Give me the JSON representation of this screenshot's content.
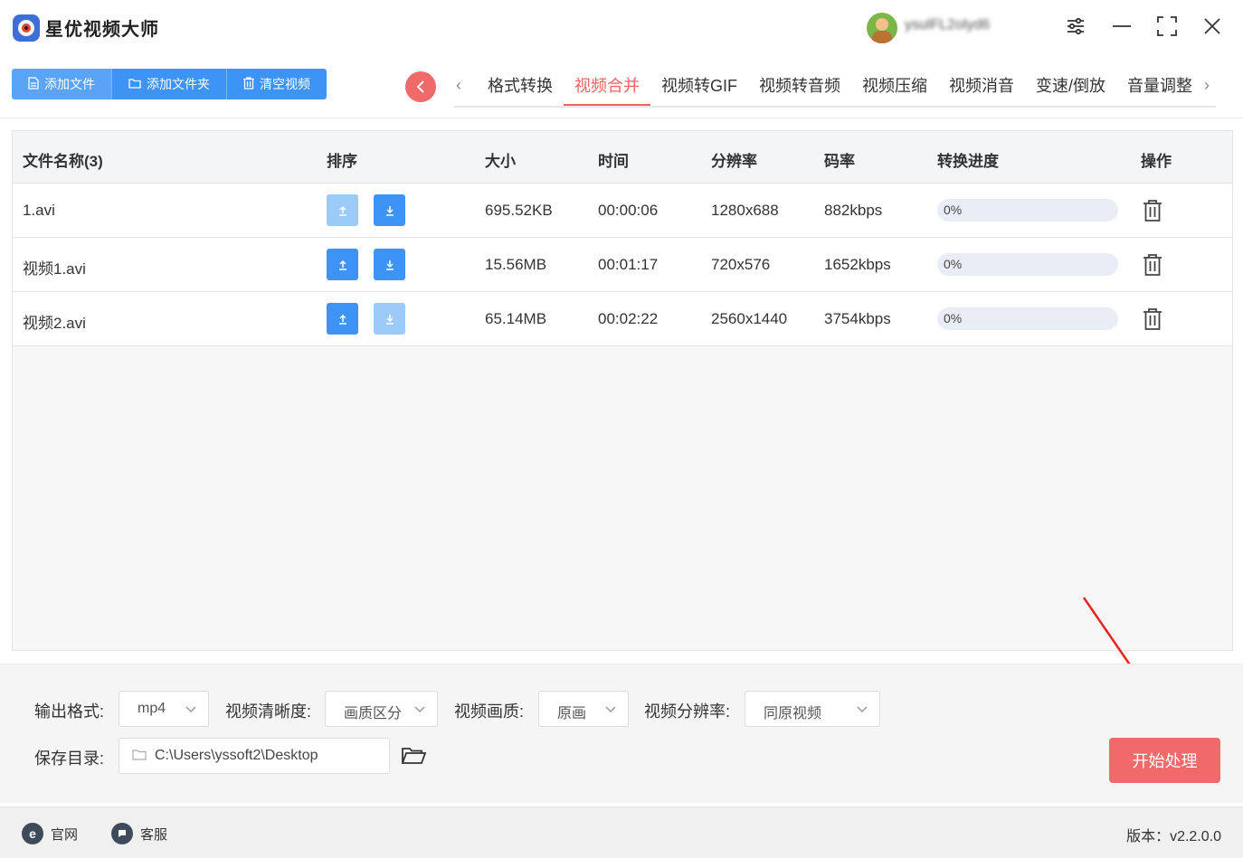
{
  "app": {
    "title": "星优视频大师",
    "username": "ysulFL2olyd6"
  },
  "toolbar": {
    "add_file": "添加文件",
    "add_folder": "添加文件夹",
    "clear": "清空视频"
  },
  "tabs": [
    {
      "label": "格式转换",
      "active": false
    },
    {
      "label": "视频合并",
      "active": true
    },
    {
      "label": "视频转GIF",
      "active": false
    },
    {
      "label": "视频转音频",
      "active": false
    },
    {
      "label": "视频压缩",
      "active": false
    },
    {
      "label": "视频消音",
      "active": false
    },
    {
      "label": "变速/倒放",
      "active": false
    },
    {
      "label": "音量调整",
      "active": false
    }
  ],
  "table": {
    "headers": {
      "name": "文件名称(3)",
      "order": "排序",
      "size": "大小",
      "time": "时间",
      "resolution": "分辨率",
      "bitrate": "码率",
      "progress": "转换进度",
      "action": "操作"
    },
    "rows": [
      {
        "name": "1.avi",
        "size": "695.52KB",
        "time": "00:00:06",
        "resolution": "1280x688",
        "bitrate": "882kbps",
        "progress": "0%",
        "progress_value": 0,
        "up_enabled": false,
        "down_enabled": true
      },
      {
        "name": "视频1.avi",
        "size": "15.56MB",
        "time": "00:01:17",
        "resolution": "720x576",
        "bitrate": "1652kbps",
        "progress": "0%",
        "progress_value": 0,
        "up_enabled": true,
        "down_enabled": true
      },
      {
        "name": "视频2.avi",
        "size": "65.14MB",
        "time": "00:02:22",
        "resolution": "2560x1440",
        "bitrate": "3754kbps",
        "progress": "0%",
        "progress_value": 0,
        "up_enabled": true,
        "down_enabled": false
      }
    ]
  },
  "settings": {
    "format_label": "输出格式:",
    "format_value": "mp4",
    "clarity_label": "视频清晰度:",
    "clarity_value": "画质区分",
    "quality_label": "视频画质:",
    "quality_value": "原画",
    "resolution_label": "视频分辨率:",
    "resolution_value": "同原视频",
    "save_label": "保存目录:",
    "save_path": "C:\\Users\\yssoft2\\Desktop",
    "start": "开始处理"
  },
  "status": {
    "website": "官网",
    "support": "客服",
    "version": "版本：v2.2.0.0"
  },
  "colors": {
    "accent_blue": "#3d94f6",
    "accent_red": "#ef6262",
    "annotation_red": "#e8261f"
  }
}
